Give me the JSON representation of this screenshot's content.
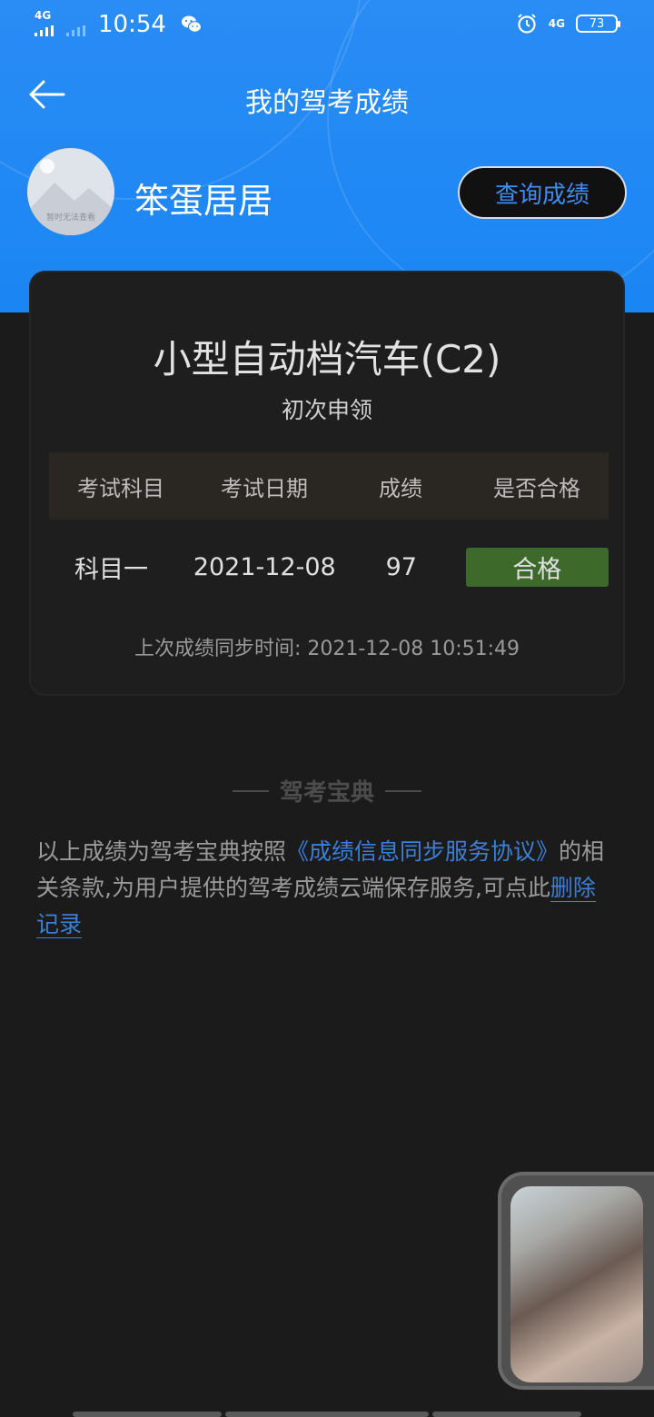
{
  "status_bar": {
    "left_network": "4G",
    "time": "10:54",
    "right_network": "4G",
    "battery": "73",
    "icons": [
      "signal-icon",
      "wechat-icon",
      "alarm-icon",
      "battery-icon"
    ]
  },
  "nav": {
    "title": "我的驾考成绩",
    "back_icon": "arrow-left-icon"
  },
  "profile": {
    "avatar_placeholder": "暂时无法查看",
    "username": "笨蛋居居",
    "query_button": "查询成绩"
  },
  "result_card": {
    "title": "小型自动档汽车(C2)",
    "subtitle": "初次申领",
    "headers": [
      "考试科目",
      "考试日期",
      "成绩",
      "是否合格"
    ],
    "rows": [
      {
        "subject": "科目一",
        "date": "2021-12-08",
        "score": "97",
        "status": "合格"
      }
    ],
    "sync_label": "上次成绩同步时间: 2021-12-08 10:51:49"
  },
  "footer": {
    "brand": "驾考宝典",
    "notice_prefix": "以上成绩为驾考宝典按照",
    "agreement_link": "《成绩信息同步服务协议》",
    "notice_middle": "的相关条款,为用户提供的驾考成绩云端保存服务,可点此",
    "delete_link": "删除记录"
  },
  "colors": {
    "header_blue": "#1a86f3",
    "link_blue": "#3b7fd6",
    "pass_green": "#6ad33f",
    "background": "#1b1b1c"
  }
}
